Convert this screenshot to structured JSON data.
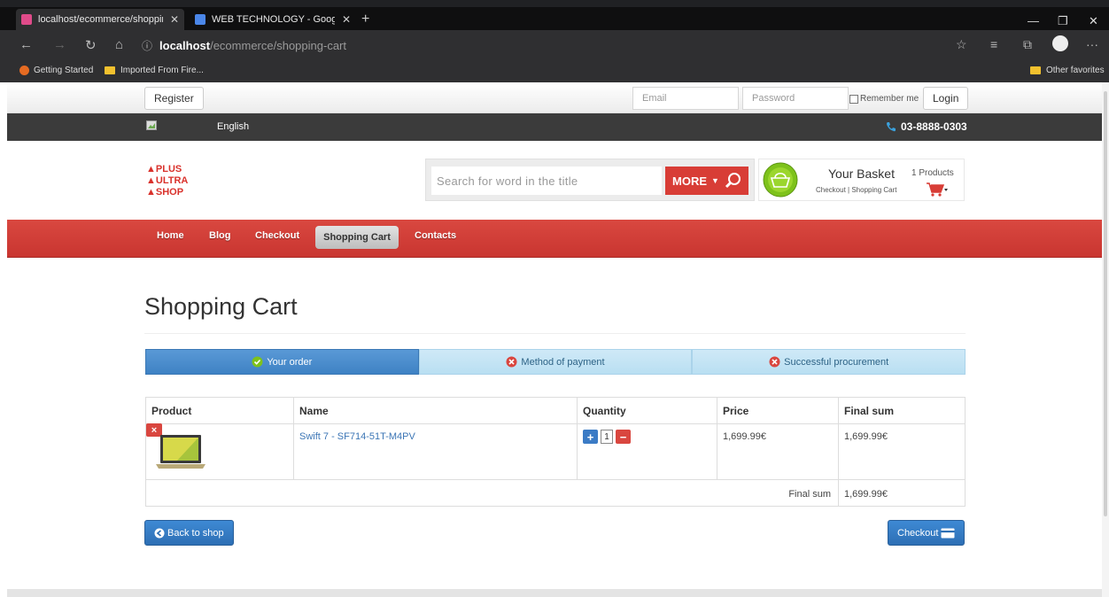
{
  "browser": {
    "tabs": [
      {
        "title": "localhost/ecommerce/shopping",
        "close": "✕"
      },
      {
        "title": "WEB TECHNOLOGY - Google Do",
        "close": "✕"
      }
    ],
    "new_tab": "+",
    "url_host": "localhost",
    "url_path": "/ecommerce/shopping-cart",
    "bookmarks": [
      "Getting Started",
      "Imported From Fire...",
      "Other favorites"
    ],
    "window_controls": {
      "minimize": "—",
      "maximize": "❐",
      "close": "✕"
    }
  },
  "topbar": {
    "register_label": "Register",
    "email_placeholder": "Email",
    "password_placeholder": "Password",
    "remember_label": "Remember me",
    "login_label": "Login"
  },
  "infobar": {
    "language": "English",
    "phone": "03-8888-0303"
  },
  "header": {
    "logo_lines": [
      "PLUS",
      "ULTRA",
      "SHOP"
    ],
    "search_placeholder": "Search for word in the title",
    "more_label": "MORE",
    "basket_title": "Your Basket",
    "basket_count": "1 Products",
    "basket_link_checkout": "Checkout",
    "basket_link_separator": "|",
    "basket_link_cart": "Shopping Cart"
  },
  "nav": {
    "items": [
      "Home",
      "Blog",
      "Checkout",
      "Shopping Cart",
      "Contacts"
    ],
    "active": "Shopping Cart"
  },
  "page": {
    "title": "Shopping Cart"
  },
  "steps": [
    {
      "label": "Your order",
      "status": "done"
    },
    {
      "label": "Method of payment",
      "status": "pending"
    },
    {
      "label": "Successful procurement",
      "status": "pending"
    }
  ],
  "cart": {
    "headers": [
      "Product",
      "Name",
      "Quantity",
      "Price",
      "Final sum"
    ],
    "rows": [
      {
        "remove": "×",
        "name": "Swift 7 - SF714-51T-M4PV",
        "quantity": "1",
        "price": "1,699.99€",
        "final_sum": "1,699.99€"
      }
    ],
    "total_label": "Final sum",
    "total_value": "1,699.99€"
  },
  "actions": {
    "back_label": "Back to shop",
    "checkout_label": "Checkout"
  },
  "colors": {
    "brand_red": "#d83d36",
    "button_blue": "#2d6fb4",
    "dark_bar": "#3b3b3b"
  }
}
